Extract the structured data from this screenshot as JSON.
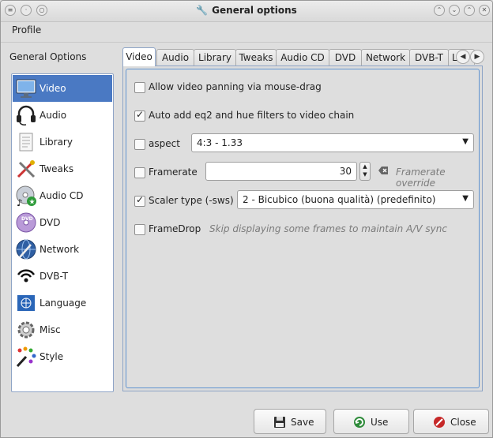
{
  "window": {
    "title": "General options"
  },
  "menu": {
    "profile": "Profile"
  },
  "sidebar": {
    "heading": "General Options",
    "items": [
      {
        "label": "Video",
        "icon": "monitor-icon"
      },
      {
        "label": "Audio",
        "icon": "headset-icon"
      },
      {
        "label": "Library",
        "icon": "library-icon"
      },
      {
        "label": "Tweaks",
        "icon": "tweaks-icon"
      },
      {
        "label": "Audio CD",
        "icon": "audio-cd-icon"
      },
      {
        "label": "DVD",
        "icon": "dvd-icon"
      },
      {
        "label": "Network",
        "icon": "network-icon"
      },
      {
        "label": "DVB-T",
        "icon": "dvbt-icon"
      },
      {
        "label": "Language",
        "icon": "language-icon"
      },
      {
        "label": "Misc",
        "icon": "gear-icon"
      },
      {
        "label": "Style",
        "icon": "palette-icon"
      }
    ],
    "selected": "Video"
  },
  "tabs": [
    "Video",
    "Audio",
    "Library",
    "Tweaks",
    "Audio CD",
    "DVD",
    "Network",
    "DVB-T",
    "L"
  ],
  "video": {
    "allow_panning": {
      "label": "Allow video panning via mouse-drag",
      "checked": false
    },
    "auto_eq2": {
      "label": "Auto add eq2 and hue filters to video chain",
      "checked": true
    },
    "aspect": {
      "label": "aspect",
      "checked": false,
      "value": "4:3 - 1.33"
    },
    "framerate": {
      "label": "Framerate",
      "checked": false,
      "value": "30",
      "hint": "Framerate override"
    },
    "scaler": {
      "label": "Scaler type (-sws)",
      "checked": true,
      "value": "2 - Bicubico (buona qualità) (predefinito)"
    },
    "framedrop": {
      "label": "FrameDrop",
      "checked": false,
      "hint": "Skip displaying some frames to maintain A/V sync"
    }
  },
  "buttons": {
    "save": "Save",
    "use": "Use",
    "close": "Close"
  },
  "colors": {
    "selection": "#4a79c3",
    "focus_border": "#5f93d0"
  }
}
